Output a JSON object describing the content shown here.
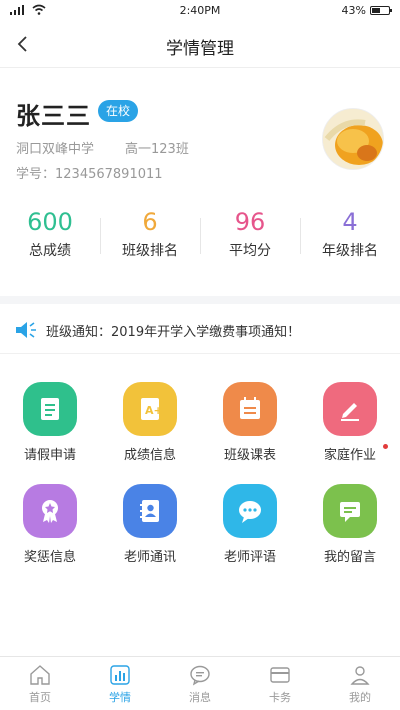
{
  "status_bar": {
    "time": "2:40PM",
    "battery": "43%"
  },
  "header": {
    "title": "学情管理"
  },
  "profile": {
    "name": "张三三",
    "badge": "在校",
    "school": "洞口双峰中学",
    "class_name": "高一123班",
    "student_id": "学号：1234567891011"
  },
  "stats": [
    {
      "value": "600",
      "label": "总成绩",
      "color": "#2fbf91"
    },
    {
      "value": "6",
      "label": "班级排名",
      "color": "#f0a93b"
    },
    {
      "value": "96",
      "label": "平均分",
      "color": "#e6558b"
    },
    {
      "value": "4",
      "label": "年级排名",
      "color": "#8a6fd6"
    }
  ],
  "notice": {
    "text": "班级通知：2019年开学入学缴费事项通知！"
  },
  "grid": [
    {
      "label": "请假申请",
      "icon": "document-icon",
      "color": "#2fc08c"
    },
    {
      "label": "成绩信息",
      "icon": "grade-a-plus-icon",
      "color": "#f2c23a"
    },
    {
      "label": "班级课表",
      "icon": "schedule-icon",
      "color": "#ef8a4a"
    },
    {
      "label": "家庭作业",
      "icon": "pencil-icon",
      "color": "#ef6a7e"
    },
    {
      "label": "奖惩信息",
      "icon": "award-icon",
      "color": "#b77be2"
    },
    {
      "label": "老师通讯",
      "icon": "contacts-icon",
      "color": "#4a83e6"
    },
    {
      "label": "老师评语",
      "icon": "chat-bubble-icon",
      "color": "#2fb7e8"
    },
    {
      "label": "我的留言",
      "icon": "message-icon",
      "color": "#7cc14d"
    }
  ],
  "tabs": [
    {
      "label": "首页",
      "icon": "home-icon"
    },
    {
      "label": "学情",
      "icon": "chart-icon"
    },
    {
      "label": "消息",
      "icon": "message-bubble-icon"
    },
    {
      "label": "卡务",
      "icon": "card-icon"
    },
    {
      "label": "我的",
      "icon": "user-icon"
    }
  ],
  "active_color": "#2aa3e6"
}
